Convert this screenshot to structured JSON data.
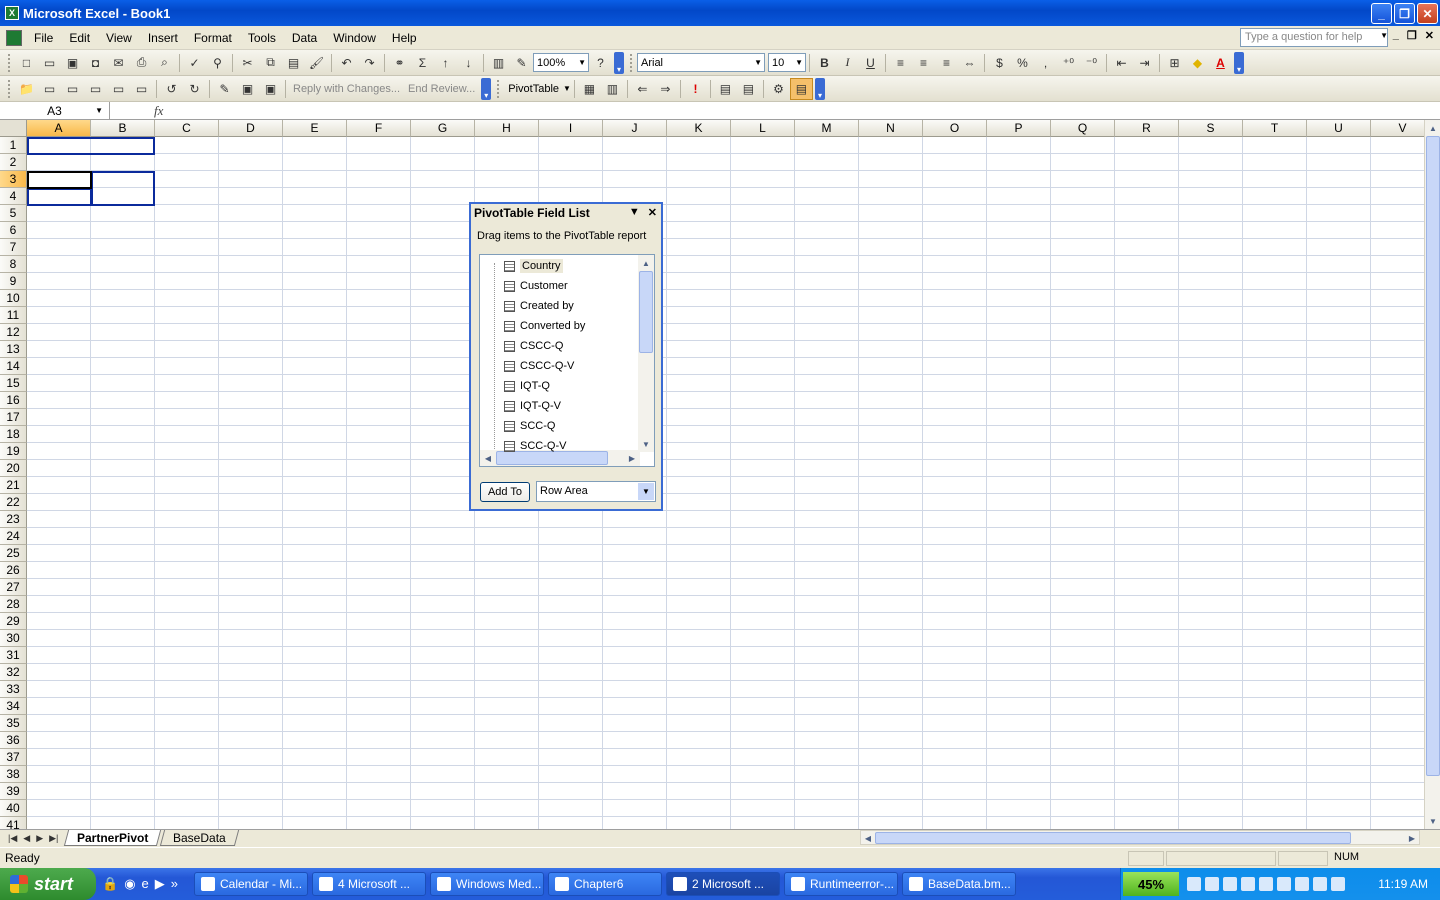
{
  "window": {
    "title": "Microsoft Excel - Book1",
    "min": "_",
    "max": "❐",
    "close": "✕"
  },
  "menu": {
    "items": [
      "File",
      "Edit",
      "View",
      "Insert",
      "Format",
      "Tools",
      "Data",
      "Window",
      "Help"
    ],
    "help_placeholder": "Type a question for help"
  },
  "toolbar1": {
    "zoom": "100%",
    "font": "Arial",
    "size": "10",
    "bold": "B",
    "italic": "I",
    "underline": "U",
    "currency": "$",
    "percent": "%",
    "comma": ","
  },
  "toolbar2": {
    "reply": "Reply with Changes...",
    "end_review": "End Review...",
    "pivot_menu": "PivotTable"
  },
  "formula": {
    "namebox": "A3",
    "fx": "fx"
  },
  "columns": [
    "A",
    "B",
    "C",
    "D",
    "E",
    "F",
    "G",
    "H",
    "I",
    "J",
    "K",
    "L",
    "M",
    "N",
    "O",
    "P",
    "Q",
    "R",
    "S",
    "T",
    "U",
    "V"
  ],
  "rows": [
    "1",
    "2",
    "3",
    "4",
    "5",
    "6",
    "7",
    "8",
    "9",
    "10",
    "11",
    "12",
    "13",
    "14",
    "15",
    "16",
    "17",
    "18",
    "19",
    "20",
    "21",
    "22",
    "23",
    "24",
    "25",
    "26",
    "27",
    "28",
    "29",
    "30",
    "31",
    "32",
    "33",
    "34",
    "35",
    "36",
    "37",
    "38",
    "39",
    "40",
    "41"
  ],
  "sheets": {
    "tab1": "PartnerPivot",
    "tab2": "BaseData"
  },
  "status": {
    "left": "Ready",
    "num": "NUM"
  },
  "pivot_panel": {
    "title": "PivotTable Field List",
    "description": "Drag items to the PivotTable report",
    "fields": [
      "Country",
      "Customer",
      "Created by",
      "Converted by",
      "CSCC-Q",
      "CSCC-Q-V",
      "IQT-Q",
      "IQT-Q-V",
      "SCC-Q",
      "SCC-Q-V"
    ],
    "add_button": "Add To",
    "area": "Row Area"
  },
  "taskbar": {
    "start": "start",
    "tasks": [
      "Calendar - Mi...",
      "4 Microsoft ...",
      "Windows Med...",
      "Chapter6",
      "2 Microsoft ...",
      "Runtimeerror-...",
      "BaseData.bm..."
    ],
    "battery": "45%",
    "clock": "11:19 AM"
  }
}
